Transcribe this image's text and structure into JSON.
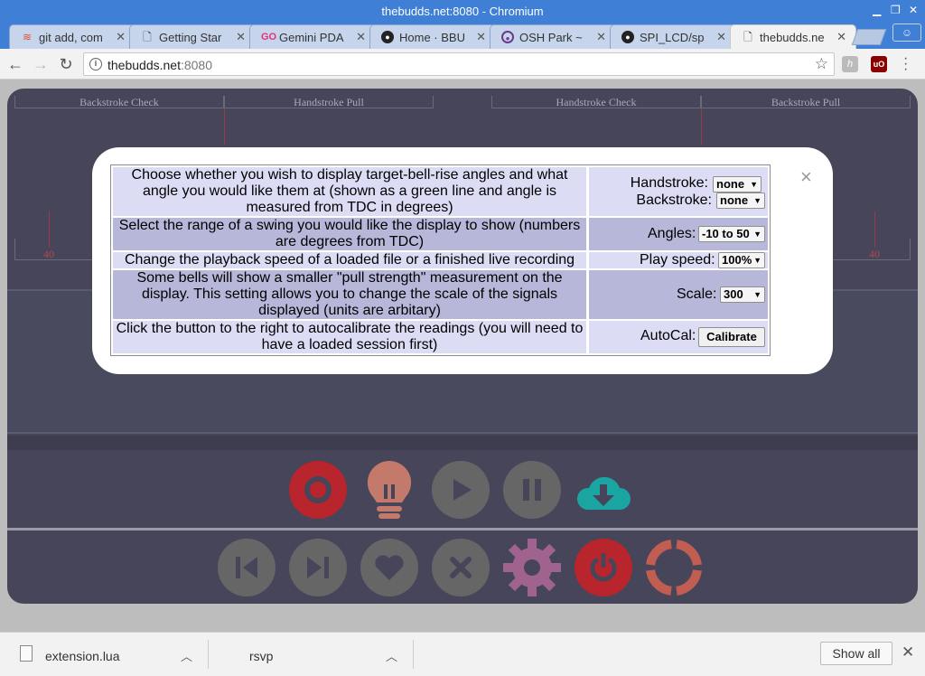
{
  "window": {
    "title": "thebudds.net:8080 - Chromium"
  },
  "tabs": [
    {
      "icon": "git-scm-icon",
      "label": "git add, com"
    },
    {
      "icon": "document-icon",
      "label": "Getting Star"
    },
    {
      "icon": "go-icon",
      "label": "Gemini PDA"
    },
    {
      "icon": "github-icon",
      "label": "Home · BBU"
    },
    {
      "icon": "osh-park-icon",
      "label": "OSH Park ~"
    },
    {
      "icon": "github-icon",
      "label": "SPI_LCD/sp"
    },
    {
      "icon": "document-icon",
      "label": "thebudds.ne"
    }
  ],
  "address": {
    "host": "thebudds.net",
    "port": ":8080"
  },
  "display": {
    "headers": [
      "Backstroke Check",
      "Handstroke Pull",
      "Handstroke Check",
      "Backstroke Pull"
    ],
    "tick_left": "40",
    "tick_right": "40"
  },
  "settings": {
    "rows": [
      {
        "description": "Choose whether you wish to display target-bell-rise angles and what angle you would like them at (shown as a green line and angle is measured from TDC in degrees)",
        "controls": [
          {
            "label": "Handstroke:",
            "value": "none"
          },
          {
            "label": "Backstroke:",
            "value": "none"
          }
        ]
      },
      {
        "description": "Select the range of a swing you would like the display to show (numbers are degrees from TDC)",
        "controls": [
          {
            "label": "Angles:",
            "value": "-10 to 50"
          }
        ]
      },
      {
        "description": "Change the playback speed of a loaded file or a finished live recording",
        "controls": [
          {
            "label": "Play speed:",
            "value": "100%"
          }
        ]
      },
      {
        "description": "Some bells will show a smaller \"pull strength\" measurement on the display. This setting allows you to change the scale of the signals displayed (units are arbitary)",
        "controls": [
          {
            "label": "Scale:",
            "value": "300"
          }
        ]
      },
      {
        "description": "Click the button to the right to autocalibrate the readings (you will need to have a loaded session first)",
        "controls": [
          {
            "label": "AutoCal:",
            "button": "Calibrate"
          }
        ]
      }
    ],
    "close": "×"
  },
  "controls_row1": [
    {
      "name": "record-button",
      "color": "#b8252c"
    },
    {
      "name": "bulb-button",
      "color": "#c47a6a"
    },
    {
      "name": "play-button",
      "color": "#666666"
    },
    {
      "name": "pause-button",
      "color": "#666666"
    },
    {
      "name": "download-button",
      "color": "#1aa5a3"
    }
  ],
  "controls_row2": [
    {
      "name": "skip-back-button",
      "color": "#666666"
    },
    {
      "name": "skip-forward-button",
      "color": "#666666"
    },
    {
      "name": "heart-button",
      "color": "#666666"
    },
    {
      "name": "cancel-button",
      "color": "#666666"
    },
    {
      "name": "settings-button",
      "color": "#a0638f"
    },
    {
      "name": "power-button",
      "color": "#b8252c"
    },
    {
      "name": "help-button",
      "color": "#c25d52"
    }
  ],
  "downloads": [
    {
      "name": "extension.lua"
    },
    {
      "name": "rsvp"
    }
  ],
  "shelf": {
    "show_all": "Show all",
    "close": "✕"
  }
}
